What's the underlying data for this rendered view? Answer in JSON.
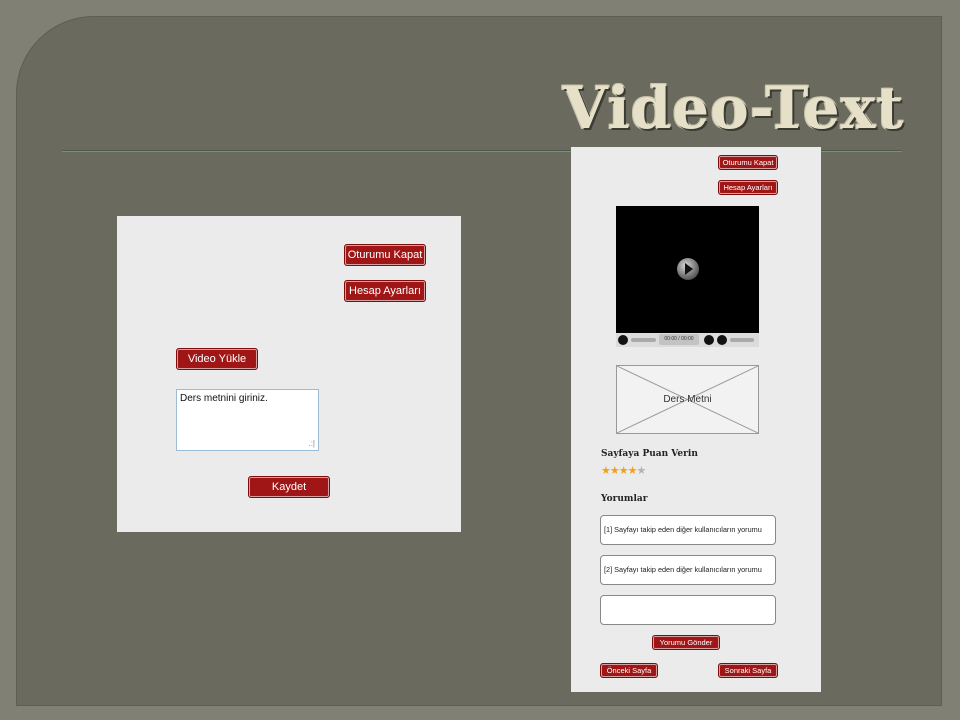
{
  "slide": {
    "title": "Video-Text"
  },
  "left_mockup": {
    "logout_label": "Oturumu Kapat",
    "account_label": "Hesap Ayarları",
    "upload_label": "Video Yükle",
    "text_value": "Ders metnini giriniz.",
    "save_label": "Kaydet"
  },
  "right_mockup": {
    "logout_label": "Oturumu Kapat",
    "account_label": "Hesap Ayarları",
    "video_time": "00:00 / 00:00",
    "placeholder_label": "Ders Metni",
    "rating_heading": "Sayfaya Puan Verin",
    "rating": {
      "value": 4,
      "max": 5
    },
    "comments_heading": "Yorumlar",
    "comments": [
      "[1] Sayfayı takip eden diğer kullanıcıların yorumu",
      "[2] Sayfayı takip eden diğer kullanıcıların yorumu"
    ],
    "comment_input_value": "",
    "submit_comment_label": "Yorumu Gönder",
    "prev_page_label": "Önceki Sayfa",
    "next_page_label": "Sonraki Sayfa"
  },
  "colors": {
    "button": "#a01616",
    "slide_bg": "#6a6b5e",
    "title": "#e6e0c8",
    "mock_bg": "#ebebeb"
  },
  "icons": [
    "play-icon",
    "pause-icon",
    "replay-icon",
    "volume-icon",
    "star-icon",
    "resize-grip-icon"
  ]
}
